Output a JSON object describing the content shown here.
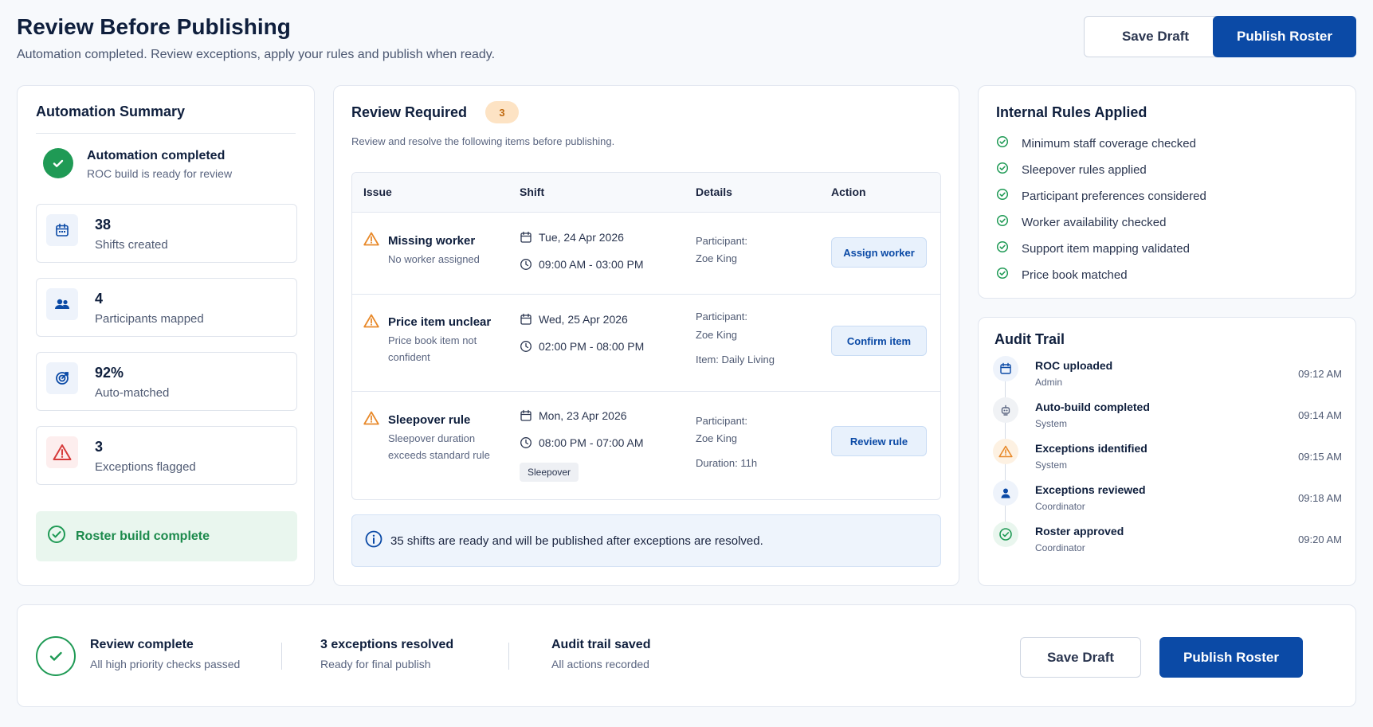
{
  "header": {
    "title": "Review Before Publishing",
    "subtitle": "Automation completed. Review exceptions, apply your rules and publish when ready.",
    "save_draft": "Save Draft",
    "publish": "Publish Roster"
  },
  "summary": {
    "title": "Automation Summary",
    "status_title": "Automation completed",
    "status_sub": "ROC build is ready for review",
    "stats": [
      {
        "value": "38",
        "label": "Shifts created",
        "icon": "calendar-icon"
      },
      {
        "value": "4",
        "label": "Participants mapped",
        "icon": "users-icon"
      },
      {
        "value": "92%",
        "label": "Auto-matched",
        "icon": "target-icon"
      },
      {
        "value": "3",
        "label": "Exceptions flagged",
        "icon": "warning-icon"
      }
    ],
    "complete_label": "Roster build complete"
  },
  "review": {
    "title": "Review Required",
    "count": "3",
    "description": "Review and resolve the following items before publishing.",
    "columns": [
      "Issue",
      "Shift",
      "Details",
      "Action"
    ],
    "rows": [
      {
        "issue": "Missing worker",
        "issue_sub": "No worker assigned",
        "date": "Tue, 24 Apr 2026",
        "time": "09:00 AM - 03:00 PM",
        "detail_label": "Participant:",
        "detail_value": "Zoe King",
        "action": "Assign worker"
      },
      {
        "issue": "Price item unclear",
        "issue_sub": "Price book item not confident",
        "date": "Wed, 25 Apr 2026",
        "time": "02:00 PM - 08:00 PM",
        "detail_label": "Participant:",
        "detail_value": "Zoe King",
        "detail_extra": "Item:  Daily Living",
        "action": "Confirm item"
      },
      {
        "issue": "Sleepover rule",
        "issue_sub": "Sleepover duration exceeds standard rule",
        "date": "Mon, 23 Apr 2026",
        "time": "08:00 PM - 07:00 AM",
        "tag": "Sleepover",
        "detail_label": "Participant:",
        "detail_value": "Zoe King",
        "detail_extra": "Duration:  11h",
        "action": "Review rule"
      }
    ],
    "info": "35 shifts are ready and will be published after exceptions are resolved."
  },
  "rules": {
    "title": "Internal Rules Applied",
    "items": [
      "Minimum staff coverage checked",
      "Sleepover rules applied",
      "Participant preferences considered",
      "Worker availability checked",
      "Support item mapping validated",
      "Price book matched"
    ]
  },
  "audit": {
    "title": "Audit Trail",
    "items": [
      {
        "title": "ROC uploaded",
        "actor": "Admin",
        "time": "09:12 AM",
        "icon": "upload-icon"
      },
      {
        "title": "Auto-build completed",
        "actor": "System",
        "time": "09:14 AM",
        "icon": "robot-icon"
      },
      {
        "title": "Exceptions identified",
        "actor": "System",
        "time": "09:15 AM",
        "icon": "warning-icon"
      },
      {
        "title": "Exceptions reviewed",
        "actor": "Coordinator",
        "time": "09:18 AM",
        "icon": "user-icon"
      },
      {
        "title": "Roster approved",
        "actor": "Coordinator",
        "time": "09:20 AM",
        "icon": "check-icon"
      }
    ]
  },
  "footer": {
    "review_title": "Review complete",
    "review_sub": "All high priority checks passed",
    "exceptions_title": "3 exceptions resolved",
    "exceptions_sub": "Ready for final publish",
    "audit_title": "Audit trail saved",
    "audit_sub": "All actions recorded",
    "save_draft": "Save Draft",
    "publish": "Publish Roster"
  },
  "colors": {
    "primary": "#0b4aa6",
    "success": "#1f9a55",
    "warning": "#e8892a",
    "danger": "#d63b3b"
  }
}
